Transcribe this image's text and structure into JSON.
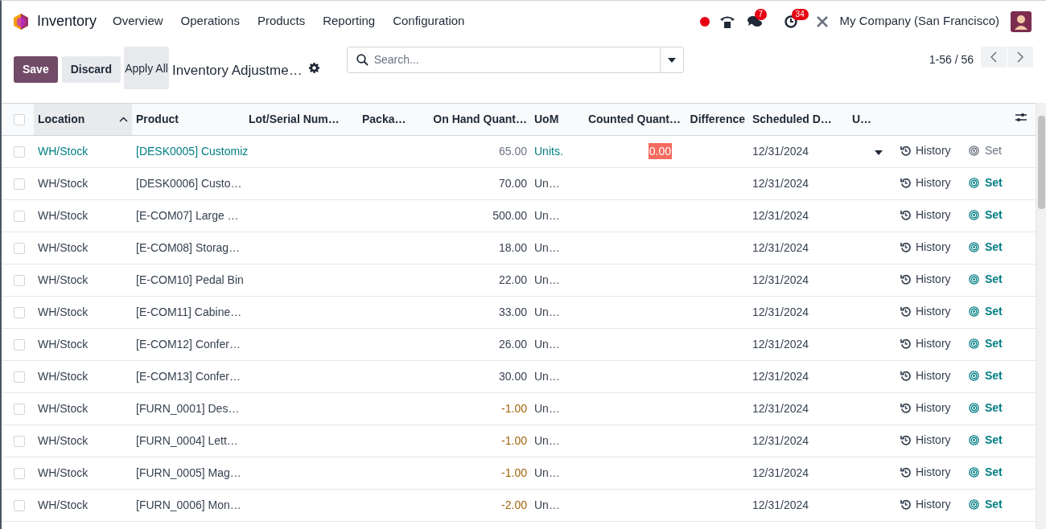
{
  "nav": {
    "app": "Inventory",
    "menu": [
      "Overview",
      "Operations",
      "Products",
      "Reporting",
      "Configuration"
    ],
    "messages_count": "7",
    "activities_count": "34",
    "company": "My Company (San Francisco)"
  },
  "control": {
    "buttons": [
      "Save",
      "Discard",
      "Apply All"
    ],
    "title": "Inventory Adjustme…",
    "search": {
      "placeholder": "Search..."
    },
    "pager": "1-56 / 56"
  },
  "table": {
    "all_checked": false,
    "columns": [
      {
        "label": "Location",
        "sorted": true
      },
      {
        "label": "Product",
        "sorted": false
      },
      {
        "label": "Lot/Serial Num…",
        "sorted": false
      },
      {
        "label": "Packa…",
        "sorted": false
      },
      {
        "label": "On Hand Quant…",
        "sorted": false
      },
      {
        "label": "UoM",
        "sorted": false
      },
      {
        "label": "Counted Quant…",
        "sorted": false
      },
      {
        "label": "Difference",
        "sorted": false
      },
      {
        "label": "Scheduled D…",
        "sorted": false
      },
      {
        "label": "U…",
        "sorted": false
      }
    ],
    "rows": [
      {
        "location": "WH/Stock",
        "product": "[DESK0005] Customiz",
        "on_hand": "65.00",
        "uom": "Units.",
        "counted": "0.00",
        "date": "12/31/2024",
        "checked": false,
        "editing": true,
        "negative": false,
        "history": "History",
        "set": "Set"
      },
      {
        "location": "WH/Stock",
        "product": "[DESK0006] Custo…",
        "on_hand": "70.00",
        "uom": "Un…",
        "date": "12/31/2024",
        "checked": false,
        "editing": false,
        "negative": false,
        "history": "History",
        "set": "Set"
      },
      {
        "location": "WH/Stock",
        "product": "[E-COM07] Large …",
        "on_hand": "500.00",
        "uom": "Un…",
        "date": "12/31/2024",
        "checked": false,
        "editing": false,
        "negative": false,
        "history": "History",
        "set": "Set"
      },
      {
        "location": "WH/Stock",
        "product": "[E-COM08] Storag…",
        "on_hand": "18.00",
        "uom": "Un…",
        "date": "12/31/2024",
        "checked": false,
        "editing": false,
        "negative": false,
        "history": "History",
        "set": "Set"
      },
      {
        "location": "WH/Stock",
        "product": "[E-COM10] Pedal Bin",
        "on_hand": "22.00",
        "uom": "Un…",
        "date": "12/31/2024",
        "checked": false,
        "editing": false,
        "negative": false,
        "history": "History",
        "set": "Set"
      },
      {
        "location": "WH/Stock",
        "product": "[E-COM11] Cabine…",
        "on_hand": "33.00",
        "uom": "Un…",
        "date": "12/31/2024",
        "checked": false,
        "editing": false,
        "negative": false,
        "history": "History",
        "set": "Set"
      },
      {
        "location": "WH/Stock",
        "product": "[E-COM12] Confer…",
        "on_hand": "26.00",
        "uom": "Un…",
        "date": "12/31/2024",
        "checked": false,
        "editing": false,
        "negative": false,
        "history": "History",
        "set": "Set"
      },
      {
        "location": "WH/Stock",
        "product": "[E-COM13] Confer…",
        "on_hand": "30.00",
        "uom": "Un…",
        "date": "12/31/2024",
        "checked": false,
        "editing": false,
        "negative": false,
        "history": "History",
        "set": "Set"
      },
      {
        "location": "WH/Stock",
        "product": "[FURN_0001] Des…",
        "on_hand": "-1.00",
        "uom": "Un…",
        "date": "12/31/2024",
        "checked": false,
        "editing": false,
        "negative": true,
        "history": "History",
        "set": "Set"
      },
      {
        "location": "WH/Stock",
        "product": "[FURN_0004] Lett…",
        "on_hand": "-1.00",
        "uom": "Un…",
        "date": "12/31/2024",
        "checked": false,
        "editing": false,
        "negative": true,
        "history": "History",
        "set": "Set"
      },
      {
        "location": "WH/Stock",
        "product": "[FURN_0005] Mag…",
        "on_hand": "-1.00",
        "uom": "Un…",
        "date": "12/31/2024",
        "checked": false,
        "editing": false,
        "negative": true,
        "history": "History",
        "set": "Set"
      },
      {
        "location": "WH/Stock",
        "product": "[FURN_0006] Mon…",
        "on_hand": "-2.00",
        "uom": "Un…",
        "date": "12/31/2024",
        "checked": false,
        "editing": false,
        "negative": true,
        "history": "History",
        "set": "Set"
      }
    ]
  }
}
